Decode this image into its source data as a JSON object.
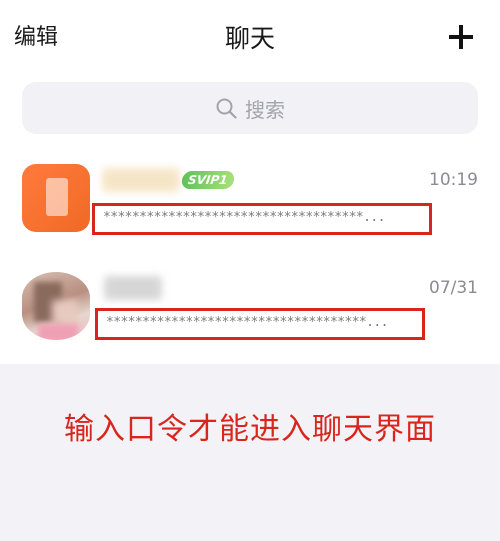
{
  "header": {
    "edit_label": "编辑",
    "title": "聊天",
    "add_icon": "plus-icon"
  },
  "search": {
    "placeholder": "搜索",
    "icon": "search-icon"
  },
  "chats": [
    {
      "avatar_icon": "orange-app-avatar",
      "badge": "SVIP1",
      "time": "10:19",
      "preview": "************************************..."
    },
    {
      "avatar_icon": "photo-avatar",
      "time": "07/31",
      "preview": "************************************..."
    }
  ],
  "notice": "输入口令才能进入聊天界面",
  "colors": {
    "highlight_red": "#d9261c",
    "search_bg": "#f2f2f6",
    "bottom_bg": "#f3f3f7"
  }
}
